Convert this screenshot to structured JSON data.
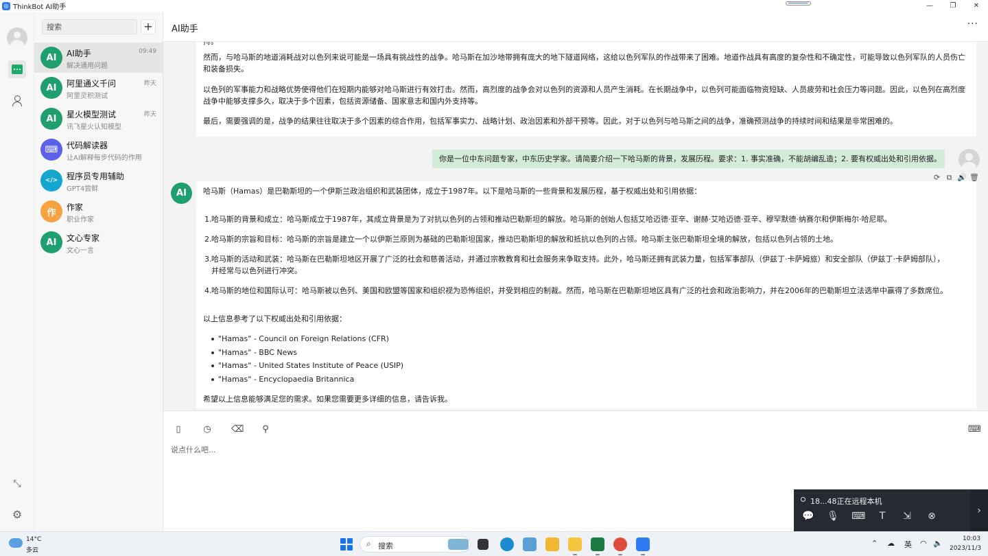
{
  "window": {
    "title": "ThinkBot AI助手",
    "controls": {
      "minimize": "—",
      "maximize": "❐",
      "close": "✕"
    }
  },
  "sidebar": {
    "search_placeholder": "搜索",
    "add_label": "+",
    "conversations": [
      {
        "avatar": "AI",
        "name": "AI助手",
        "sub": "解决通用问题",
        "time": "09:49",
        "active": true,
        "color": "#1f9e6e"
      },
      {
        "avatar": "AI",
        "name": "阿里通义千问",
        "sub": "阿里灵积测试",
        "time": "昨天",
        "color": "#1f9e6e"
      },
      {
        "avatar": "AI",
        "name": "星火模型测试",
        "sub": "讯飞星火认知模型",
        "time": "昨天",
        "color": "#1f9e6e"
      },
      {
        "avatar": "⌨",
        "name": "代码解读器",
        "sub": "让AI解释每步代码的作用",
        "time": "",
        "color": "#5b61e8"
      },
      {
        "avatar": "</>",
        "name": "程序员专用辅助",
        "sub": "GPT4尝鲜",
        "time": "",
        "color": "#14a6cf"
      },
      {
        "avatar": "作",
        "name": "作家",
        "sub": "职业作家",
        "time": "",
        "color": "#f5a340"
      },
      {
        "avatar": "AI",
        "name": "文心专家",
        "sub": "文心一言",
        "time": "",
        "color": "#1f9e6e"
      }
    ]
  },
  "main": {
    "title": "AI助手",
    "more_label": "···",
    "messages": {
      "ai_prev": {
        "line0": "持。",
        "paragraphs": [
          "然而，与哈马斯的地道消耗战对以色列来说可能是一场具有挑战性的战争。哈马斯在加沙地带拥有庞大的地下隧道网络，这给以色列军队的作战带来了困难。地道作战具有高度的复杂性和不确定性，可能导致以色列军队的人员伤亡和装备损失。",
          "以色列的军事能力和战略优势使得他们在短期内能够对哈马斯进行有效打击。然而，高烈度的战争会对以色列的资源和人员产生消耗。在长期战争中，以色列可能面临物资短缺、人员疲劳和社会压力等问题。因此，以色列在高烈度战争中能够支撑多久，取决于多个因素，包括资源储备、国家意志和国内外支持等。",
          "最后，需要强调的是，战争的结果往往取决于多个因素的综合作用，包括军事实力、战略计划、政治因素和外部干预等。因此，对于以色列与哈马斯之间的战争，准确预测战争的持续时间和结果是非常困难的。"
        ]
      },
      "user": "你是一位中东问题专家，中东历史学家。请简要介绍一下哈马斯的背景，发展历程。要求：1. 事实准确，不能胡编乱造；2. 要有权威出处和引用依据。",
      "tools": [
        "⟳",
        "⧉",
        "🔊",
        "🗑"
      ],
      "ai": {
        "avatar": "AI",
        "intro": "哈马斯（Hamas）是巴勒斯坦的一个伊斯兰政治组织和武装团体，成立于1987年。以下是哈马斯的一些背景和发展历程，基于权威出处和引用依据：",
        "items": [
          {
            "num": "1.",
            "text": "哈马斯的背景和成立：哈马斯成立于1987年，其成立背景是为了对抗以色列的占领和推动巴勒斯坦的解放。哈马斯的创始人包括艾哈迈德·亚辛、谢赫·艾哈迈德·亚辛、穆罕默德·纳赛尔和伊斯梅尔·哈尼耶。"
          },
          {
            "num": "2.",
            "text": "哈马斯的宗旨和目标：哈马斯的宗旨是建立一个以伊斯兰原则为基础的巴勒斯坦国家，推动巴勒斯坦的解放和抵抗以色列的占领。哈马斯主张巴勒斯坦全境的解放，包括以色列占领的土地。"
          },
          {
            "num": "3.",
            "text": "哈马斯的活动和武装：哈马斯在巴勒斯坦地区开展了广泛的社会和慈善活动，并通过宗教教育和社会服务来争取支持。此外，哈马斯还拥有武装力量，包括军事部队（伊兹丁·卡萨姆旅）和安全部队（伊兹丁·卡萨姆部队），并经常与以色列进行冲突。"
          },
          {
            "num": "4.",
            "text": "哈马斯的地位和国际认可：哈马斯被以色列、美国和欧盟等国家和组织视为恐怖组织，并受到相应的制裁。然而，哈马斯在巴勒斯坦地区具有广泛的社会和政治影响力，并在2006年的巴勒斯坦立法选举中赢得了多数席位。"
          }
        ],
        "sources_title": "以上信息参考了以下权威出处和引用依据：",
        "sources": [
          "\"Hamas\" - Council on Foreign Relations (CFR)",
          "\"Hamas\" - BBC News",
          "\"Hamas\" - United States Institute of Peace (USIP)",
          "\"Hamas\" - Encyclopaedia Britannica"
        ],
        "closing": "希望以上信息能够满足您的需求。如果您需要更多详细的信息，请告诉我。"
      }
    },
    "composer": {
      "placeholder": "说点什么吧..."
    }
  },
  "remote": {
    "text": "18...48正在远程本机",
    "tools": [
      "💬",
      "🎙",
      "⌨",
      "T",
      "⇲",
      "⊗"
    ],
    "expand": "›"
  },
  "taskbar": {
    "weather_temp": "14°C",
    "weather_desc": "多云",
    "search_label": "搜索",
    "tray_lang": "英",
    "clock_time": "10:03",
    "clock_date": "2023/11/3"
  }
}
